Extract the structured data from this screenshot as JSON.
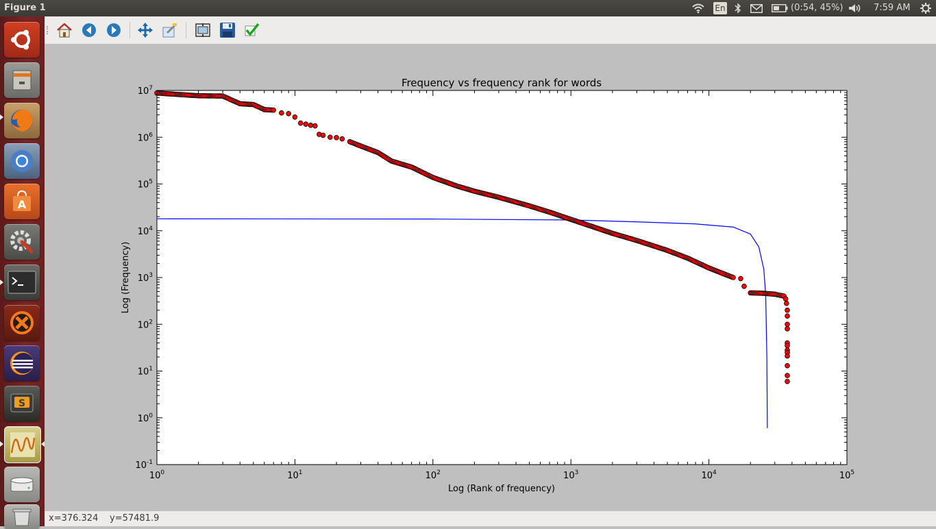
{
  "window": {
    "title": "Figure 1"
  },
  "tray": {
    "keyboard": "En",
    "battery": "(0:54, 45%)",
    "clock": "7:59 AM",
    "icons": [
      "wifi-icon",
      "keyboard-indicator",
      "bluetooth-icon",
      "mail-icon",
      "battery-icon",
      "volume-icon",
      "system-gear-icon"
    ]
  },
  "launcher": {
    "items": [
      "ubuntu-dash",
      "files",
      "firefox",
      "chromium",
      "software-center",
      "system-settings",
      "terminal",
      "xampp",
      "eclipse",
      "sublime-text",
      "system-monitor",
      "disk",
      "trash"
    ]
  },
  "toolbar": {
    "buttons": [
      "home",
      "back",
      "forward",
      "pan",
      "zoom",
      "configure-subplots",
      "save",
      "edit-parameters"
    ]
  },
  "status": {
    "x": "x=376.324",
    "y": "y=57481.9"
  },
  "chart_data": {
    "type": "scatter",
    "title": "Frequency vs frequency rank for words",
    "xlabel": "Log (Rank of frequency)",
    "ylabel": "Log (Frequency)",
    "xscale": "log",
    "yscale": "log",
    "xlim": [
      1,
      100000
    ],
    "ylim": [
      0.1,
      10000000
    ],
    "x_tick_labels": [
      "10^0",
      "10^1",
      "10^2",
      "10^3",
      "10^4",
      "10^5"
    ],
    "y_tick_labels": [
      "10^-1",
      "10^0",
      "10^1",
      "10^2",
      "10^3",
      "10^4",
      "10^5",
      "10^6",
      "10^7"
    ],
    "grid": false,
    "legend": "none",
    "series": [
      {
        "kind": "scatter",
        "color": "#ff0000",
        "edge_color": "#000000",
        "points": [
          [
            1,
            8800000
          ],
          [
            2,
            7700000
          ],
          [
            3,
            7600000
          ],
          [
            4,
            5200000
          ],
          [
            5,
            5000000
          ],
          [
            6,
            3900000
          ],
          [
            7,
            3800000
          ],
          [
            8,
            3300000
          ],
          [
            9,
            3200000
          ],
          [
            10,
            2700000
          ],
          [
            11,
            2000000
          ],
          [
            12,
            1900000
          ],
          [
            13,
            1800000
          ],
          [
            14,
            1750000
          ],
          [
            15,
            1150000
          ],
          [
            16,
            1100000
          ],
          [
            18,
            1000000
          ],
          [
            20,
            980000
          ],
          [
            22,
            920000
          ],
          [
            25,
            800000
          ],
          [
            30,
            650000
          ],
          [
            40,
            470000
          ],
          [
            50,
            310000
          ],
          [
            70,
            230000
          ],
          [
            100,
            138000
          ],
          [
            150,
            90000
          ],
          [
            200,
            70000
          ],
          [
            300,
            52000
          ],
          [
            500,
            34000
          ],
          [
            700,
            25000
          ],
          [
            1000,
            17500
          ],
          [
            2000,
            8800
          ],
          [
            3000,
            6200
          ],
          [
            5000,
            3800
          ],
          [
            7000,
            2600
          ],
          [
            10000,
            1600
          ],
          [
            15000,
            1000
          ],
          [
            17000,
            950
          ],
          [
            18000,
            650
          ],
          [
            20000,
            470
          ],
          [
            25000,
            460
          ],
          [
            30000,
            440
          ],
          [
            35000,
            400
          ],
          [
            36000,
            350
          ],
          [
            36500,
            280
          ],
          [
            37000,
            200
          ],
          [
            37000,
            150
          ],
          [
            37000,
            100
          ],
          [
            37000,
            80
          ],
          [
            37000,
            40
          ],
          [
            37000,
            35
          ],
          [
            37000,
            28
          ],
          [
            37000,
            25
          ],
          [
            37000,
            21
          ],
          [
            37000,
            13
          ],
          [
            37000,
            8
          ],
          [
            37000,
            6
          ]
        ]
      },
      {
        "kind": "line",
        "color": "#0000ff",
        "points": [
          [
            1,
            18000
          ],
          [
            100,
            17800
          ],
          [
            1000,
            17000
          ],
          [
            3000,
            15500
          ],
          [
            8000,
            14000
          ],
          [
            15000,
            12000
          ],
          [
            20000,
            8500
          ],
          [
            23000,
            4500
          ],
          [
            25000,
            1500
          ],
          [
            25800,
            400
          ],
          [
            26300,
            20
          ],
          [
            26500,
            0.6
          ]
        ]
      }
    ]
  }
}
